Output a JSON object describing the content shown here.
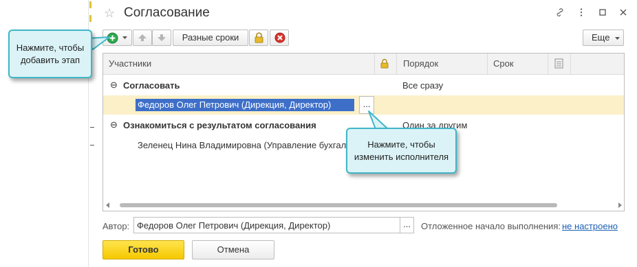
{
  "window": {
    "title": "Согласование",
    "icons": [
      "star-icon",
      "link-icon",
      "more-vertical-icon",
      "maximize-icon",
      "close-icon"
    ]
  },
  "toolbar": {
    "add_icon": "add-circle-icon",
    "up_icon": "arrow-up-icon",
    "down_icon": "arrow-down-icon",
    "different_terms_label": "Разные сроки",
    "lock_icon": "lock-icon",
    "delete_icon": "delete-icon",
    "more_label": "Еще"
  },
  "table": {
    "columns": {
      "participants": "Участники",
      "order": "Порядок",
      "term": "Срок"
    },
    "rows": [
      {
        "kind": "group",
        "label": "Согласовать",
        "order": "Все сразу"
      },
      {
        "kind": "item",
        "label": "Федоров Олег Петрович (Дирекция, Директор)",
        "selected": true,
        "ellipsis": "..."
      },
      {
        "kind": "group",
        "label": "Ознакомиться с результатом согласования",
        "order": "Один за другим"
      },
      {
        "kind": "item",
        "label": "Зеленец Нина Владимировна (Управление бухгалт"
      }
    ]
  },
  "callouts": {
    "add_stage": "Нажмите, чтобы добавить этап",
    "change_executor": "Нажмите, чтобы изменить исполнителя"
  },
  "form": {
    "author_label": "Автор:",
    "author_value": "Федоров Олег Петрович (Дирекция, Директор)",
    "author_button": "...",
    "delayed_start_label": "Отложенное начало выполнения:",
    "delayed_start_link": "не настроено"
  },
  "buttons": {
    "ok": "Готово",
    "cancel": "Отмена"
  },
  "colors": {
    "accent_yellow": "#f5c800",
    "selected_row": "#fbf0c8",
    "callout_bg": "#dbf3f7",
    "callout_border": "#3fb6c7",
    "add_green": "#2fa84f",
    "delete_red": "#d9332b",
    "link_blue": "#1a5fb4"
  }
}
